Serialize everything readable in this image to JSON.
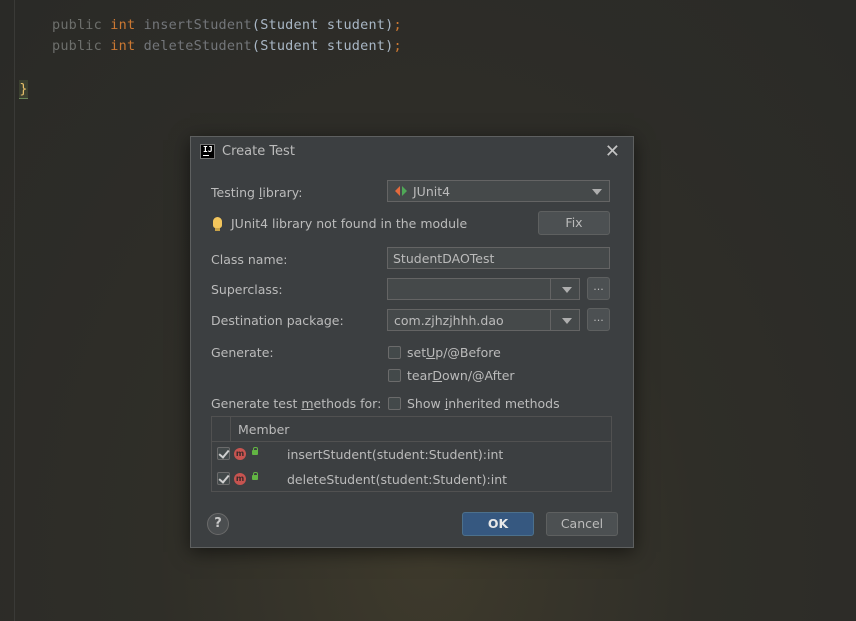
{
  "editor": {
    "lines": [
      {
        "modifier": "public",
        "type": "int",
        "method": "insertStudent",
        "params": "(Student student)",
        "semi": ";"
      },
      {
        "modifier": "public",
        "type": "int",
        "method": "deleteStudent",
        "params": "(Student student)",
        "semi": ";"
      }
    ],
    "closing_brace": "}"
  },
  "dialog": {
    "title": "Create Test",
    "app_icon_text": "IJ",
    "close_symbol": "✕",
    "testing_library": {
      "label_pre": "Testing ",
      "label_mnemonic": "l",
      "label_post": "ibrary:",
      "value": "JUnit4"
    },
    "warning": {
      "text": "JUnit4 library not found in the module",
      "fix_label": "Fix"
    },
    "class_name": {
      "label": "Class name:",
      "value": "StudentDAOTest"
    },
    "superclass": {
      "label": "Superclass:",
      "value": "",
      "browse_label": "..."
    },
    "destination_package": {
      "label": "Destination package:",
      "value": "com.zjhzjhhh.dao",
      "browse_label": "..."
    },
    "generate": {
      "label": "Generate:",
      "options": [
        {
          "pre": "set",
          "mnemonic": "U",
          "post": "p/@Before",
          "checked": false
        },
        {
          "pre": "tear",
          "mnemonic": "D",
          "post": "own/@After",
          "checked": false
        }
      ]
    },
    "methods_for": {
      "label_pre": "Generate test ",
      "label_mnemonic": "m",
      "label_post": "ethods for:",
      "show_inherited": {
        "pre": "Show ",
        "mnemonic": "i",
        "post": "nherited methods",
        "checked": false
      }
    },
    "table": {
      "header": "Member",
      "rows": [
        {
          "checked": true,
          "method_icon": "m",
          "member": "insertStudent(student:Student):int"
        },
        {
          "checked": true,
          "method_icon": "m",
          "member": "deleteStudent(student:Student):int"
        }
      ]
    },
    "help_label": "?",
    "ok_label": "OK",
    "cancel_label": "Cancel"
  },
  "colors": {
    "dialog_bg": "#3c3f41",
    "primary_button": "#365880",
    "keyword_orange": "#cc7832",
    "method_icon": "#c75450",
    "access_icon": "#62b543",
    "bulb": "#f2c55c"
  }
}
